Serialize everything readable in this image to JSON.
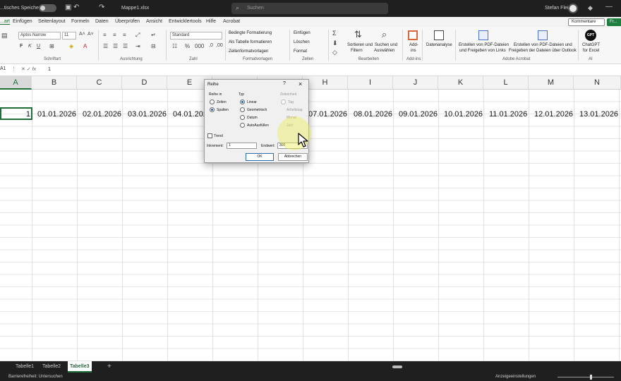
{
  "titlebar": {
    "autosave_label": "...tisches Speichern",
    "filename": "Mappe1.xlsx",
    "search_placeholder": "Suchen",
    "user_name": "Stefan Fleis"
  },
  "tabs": [
    "...art",
    "Einfügen",
    "Seitenlayout",
    "Formeln",
    "Daten",
    "Überprüfen",
    "Ansicht",
    "Entwicklertools",
    "Hilfe",
    "Acrobat"
  ],
  "tabs_right": {
    "comments": "Kommentare",
    "share": "Fr..."
  },
  "ribbon": {
    "font_name": "Aptos Narrow",
    "font_size": "11",
    "number_format": "Standard",
    "groups": [
      "Schriftart",
      "Ausrichtung",
      "Zahl",
      "Formatvorlagen",
      "Zellen",
      "Bearbeiten",
      "Add-ins",
      "Adobe Acrobat",
      "AI"
    ],
    "format_items": [
      "Bedingte Formatierung",
      "Als Tabelle formatieren",
      "Zellenformatvorlagen"
    ],
    "cells_items": [
      "Einfügen",
      "Löschen",
      "Format"
    ],
    "sort_filter": [
      "Sortieren und",
      "Filtern"
    ],
    "find_select": [
      "Suchen und",
      "Auswählen"
    ],
    "addins": [
      "Add-",
      "ins"
    ],
    "data_analysis": "Datenanalyse",
    "pdf1": [
      "Erstellen von PDF-Dateien",
      "und Freigeben von Links"
    ],
    "pdf2": [
      "Erstellen von PDF-Dateien und",
      "Freigeben der Dateien über Outlook"
    ],
    "gpt": [
      "ChatGPT",
      "for Excel"
    ],
    "gpt_badge": "GPT"
  },
  "formula_bar": {
    "name_box": "A1",
    "value": "1"
  },
  "columns": [
    "A",
    "B",
    "C",
    "D",
    "E",
    "F",
    "G",
    "H",
    "I",
    "J",
    "K",
    "L",
    "M",
    "N"
  ],
  "row_values": {
    "A": "1",
    "B": "01.01.2026",
    "C": "02.01.2026",
    "D": "03.01.2026",
    "E": "04.01.2026",
    "H": "07.01.2026",
    "I": "08.01.2026",
    "J": "09.01.2026",
    "K": "10.01.2026",
    "L": "11.01.2026",
    "M": "12.01.2026",
    "N": "13.01.2026"
  },
  "dialog": {
    "title": "Reihe",
    "help": "?",
    "close": "×",
    "reihe_in_label": "Reihe in",
    "reihe_in": [
      "Zeilen",
      "Spalten"
    ],
    "typ_label": "Typ",
    "typ": [
      "Linear",
      "Geometrisch",
      "Datum",
      "AutoAusfüllen"
    ],
    "zeiteinheit_label": "Zeiteinheit",
    "zeiteinheit": [
      "Tag",
      "Arbeitstag",
      "Monat",
      "Jahr"
    ],
    "trend": "Trend",
    "increment_label": "Inkrement:",
    "increment_value": "1",
    "endwert_label": "Endwert:",
    "endwert_value": "300",
    "ok": "OK",
    "cancel": "Abbrechen"
  },
  "sheets": [
    "Tabelle1",
    "Tabelle2",
    "Tabelle3"
  ],
  "active_sheet": "Tabelle3",
  "status": {
    "accessibility": "Barrierefreiheit: Untersuchen",
    "display_settings": "Anzeigeeinstellungen"
  },
  "colors": {
    "accent": "#1e6e37",
    "dark": "#1f1f1f"
  }
}
